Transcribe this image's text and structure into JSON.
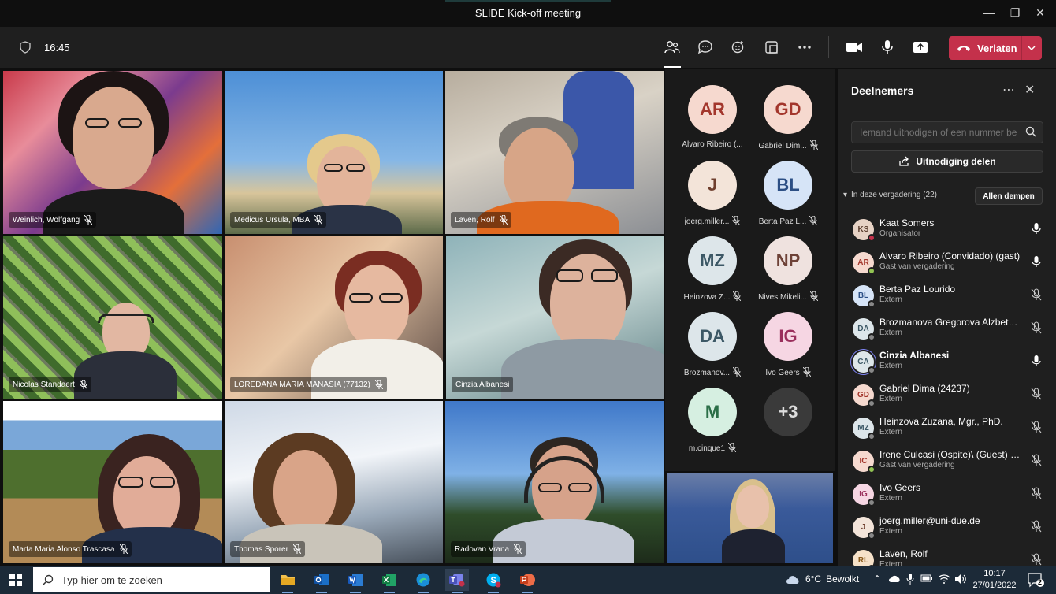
{
  "window": {
    "title": "SLIDE Kick-off meeting"
  },
  "toolbar": {
    "time": "16:45",
    "leave_label": "Verlaten"
  },
  "tiles": [
    {
      "name": "Weinlich, Wolfgang"
    },
    {
      "name": "Medicus Ursula, MBA"
    },
    {
      "name": "Laven, Rolf"
    },
    {
      "name": "Nicolas Standaert"
    },
    {
      "name": "LOREDANA MARIA MANASIA (77132)"
    },
    {
      "name": "Cinzia Albanesi"
    },
    {
      "name": "Marta Maria Alonso Trascasa"
    },
    {
      "name": "Thomas Sporer"
    },
    {
      "name": "Radovan Vrana"
    }
  ],
  "avatars": [
    {
      "initials": "AR",
      "name": "Alvaro Ribeiro (...",
      "bg": "#f6d9cf",
      "fg": "#a3362c",
      "muted": false
    },
    {
      "initials": "GD",
      "name": "Gabriel Dim...",
      "bg": "#f6d9cf",
      "fg": "#a3362c",
      "muted": true
    },
    {
      "initials": "J",
      "name": "joerg.miller...",
      "bg": "#f3e4d9",
      "fg": "#6f3f2e",
      "muted": true
    },
    {
      "initials": "BL",
      "name": "Berta Paz L...",
      "bg": "#d6e4f7",
      "fg": "#2c4f85",
      "muted": true
    },
    {
      "initials": "MZ",
      "name": "Heinzova Z...",
      "bg": "#dde6ea",
      "fg": "#3c5866",
      "muted": true
    },
    {
      "initials": "NP",
      "name": "Nives Mikeli...",
      "bg": "#efe2df",
      "fg": "#6e4238",
      "muted": true
    },
    {
      "initials": "DA",
      "name": "Brozmanov...",
      "bg": "#dde6ea",
      "fg": "#3c5866",
      "muted": true
    },
    {
      "initials": "IG",
      "name": "Ivo Geers",
      "bg": "#f6d6e3",
      "fg": "#9a2f5c",
      "muted": true
    },
    {
      "initials": "M",
      "name": "m.cinque1",
      "bg": "#d6efe1",
      "fg": "#2b6e47",
      "muted": true
    },
    {
      "initials": "+3",
      "name": "",
      "bg": "#3a3a3a",
      "fg": "#ddd",
      "muted": false
    }
  ],
  "panel": {
    "title": "Deelnemers",
    "invite_placeholder": "Iemand uitnodigen of een nummer be",
    "share_label": "Uitnodiging delen",
    "section_label": "In deze vergadering (22)",
    "mute_all_label": "Allen dempen",
    "participants": [
      {
        "initials": "KS",
        "name": "Kaat Somers",
        "role": "Organisator",
        "bg": "#e6d2c4",
        "fg": "#5a3e2e",
        "status": "#c4314b",
        "muted": false
      },
      {
        "initials": "AR",
        "name": "Alvaro Ribeiro (Convidado) (gast)",
        "role": "Gast van vergadering",
        "bg": "#f6d9cf",
        "fg": "#a3362c",
        "status": "#92c353",
        "muted": false
      },
      {
        "initials": "BL",
        "name": "Berta Paz Lourido",
        "role": "Extern",
        "bg": "#d6e4f7",
        "fg": "#2c4f85",
        "status": "#888",
        "muted": true
      },
      {
        "initials": "DA",
        "name": "Brozmanova Gregorova Alzbeta,...",
        "role": "Extern",
        "bg": "#dde6ea",
        "fg": "#3c5866",
        "status": "#888",
        "muted": true
      },
      {
        "initials": "CA",
        "name": "Cinzia Albanesi",
        "role": "Extern",
        "bg": "#dde6ea",
        "fg": "#3c5866",
        "status": "#888",
        "muted": false
      },
      {
        "initials": "GD",
        "name": "Gabriel Dima (24237)",
        "role": "Extern",
        "bg": "#f6d9cf",
        "fg": "#a3362c",
        "status": "#888",
        "muted": true
      },
      {
        "initials": "MZ",
        "name": "Heinzova Zuzana, Mgr., PhD.",
        "role": "Extern",
        "bg": "#dde6ea",
        "fg": "#3c5866",
        "status": "#888",
        "muted": true
      },
      {
        "initials": "IC",
        "name": "Irene Culcasi (Ospite)\\ (Guest) (g...",
        "role": "Gast van vergadering",
        "bg": "#f6d9cf",
        "fg": "#a3362c",
        "status": "#92c353",
        "muted": true
      },
      {
        "initials": "IG",
        "name": "Ivo Geers",
        "role": "Extern",
        "bg": "#f6d6e3",
        "fg": "#9a2f5c",
        "status": "#888",
        "muted": true
      },
      {
        "initials": "J",
        "name": "joerg.miller@uni-due.de",
        "role": "Extern",
        "bg": "#f3e4d9",
        "fg": "#6f3f2e",
        "status": "#888",
        "muted": true
      },
      {
        "initials": "RL",
        "name": "Laven, Rolf",
        "role": "Extern",
        "bg": "#f6e1c8",
        "fg": "#8a5a1c",
        "status": "#888",
        "muted": true
      }
    ]
  },
  "taskbar": {
    "search_placeholder": "Typ hier om te zoeken",
    "weather_temp": "6°C",
    "weather_text": "Bewolkt",
    "time": "10:17",
    "date": "27/01/2022",
    "notifications": "2"
  }
}
